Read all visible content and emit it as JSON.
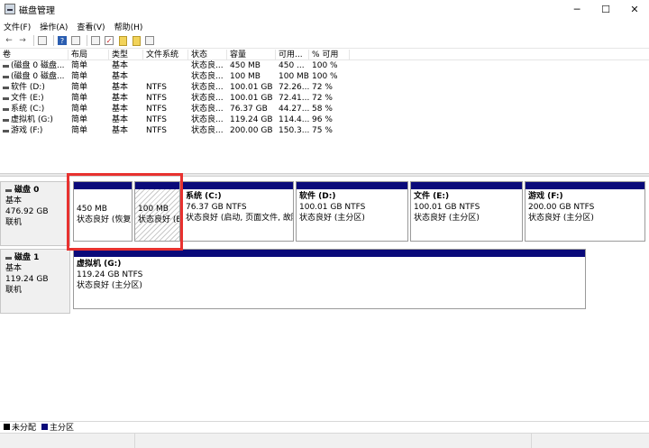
{
  "window": {
    "title": "磁盘管理",
    "minimize": "─",
    "maximize": "☐",
    "close": "✕"
  },
  "menu": [
    "文件(F)",
    "操作(A)",
    "查看(V)",
    "帮助(H)"
  ],
  "toolbar": {
    "back": "←",
    "forward": "→",
    "help": "?"
  },
  "volume_table": {
    "headers": [
      "卷",
      "布局",
      "类型",
      "文件系统",
      "状态",
      "容量",
      "可用...",
      "% 可用"
    ],
    "rows": [
      [
        "(磁盘 0 磁盘...",
        "简单",
        "基本",
        "",
        "状态良...",
        "450 MB",
        "450 ...",
        "100 %"
      ],
      [
        "(磁盘 0 磁盘...",
        "简单",
        "基本",
        "",
        "状态良...",
        "100 MB",
        "100 MB",
        "100 %"
      ],
      [
        "软件 (D:)",
        "简单",
        "基本",
        "NTFS",
        "状态良...",
        "100.01 GB",
        "72.26...",
        "72 %"
      ],
      [
        "文件 (E:)",
        "简单",
        "基本",
        "NTFS",
        "状态良...",
        "100.01 GB",
        "72.41...",
        "72 %"
      ],
      [
        "系统 (C:)",
        "简单",
        "基本",
        "NTFS",
        "状态良...",
        "76.37 GB",
        "44.27...",
        "58 %"
      ],
      [
        "虚拟机 (G:)",
        "简单",
        "基本",
        "NTFS",
        "状态良...",
        "119.24 GB",
        "114.4...",
        "96 %"
      ],
      [
        "游戏 (F:)",
        "简单",
        "基本",
        "NTFS",
        "状态良...",
        "200.00 GB",
        "150.3...",
        "75 %"
      ]
    ]
  },
  "disks": [
    {
      "name": "磁盘 0",
      "type": "基本",
      "size": "476.92 GB",
      "status": "联机",
      "partitions": [
        {
          "name": "",
          "size": "450 MB",
          "status": "状态良好 (恢复:"
        },
        {
          "name": "",
          "size": "100 MB",
          "status": "状态良好 (E"
        },
        {
          "name": "系统  (C:)",
          "size": "76.37 GB NTFS",
          "status": "状态良好 (启动, 页面文件, 故障"
        },
        {
          "name": "软件  (D:)",
          "size": "100.01 GB NTFS",
          "status": "状态良好 (主分区)"
        },
        {
          "name": "文件  (E:)",
          "size": "100.01 GB NTFS",
          "status": "状态良好 (主分区)"
        },
        {
          "name": "游戏  (F:)",
          "size": "200.00 GB NTFS",
          "status": "状态良好 (主分区)"
        }
      ]
    },
    {
      "name": "磁盘 1",
      "type": "基本",
      "size": "119.24 GB",
      "status": "联机",
      "partitions": [
        {
          "name": "虚拟机  (G:)",
          "size": "119.24 GB NTFS",
          "status": "状态良好 (主分区)"
        }
      ]
    }
  ],
  "legend": [
    {
      "label": "未分配",
      "color": "#000000"
    },
    {
      "label": "主分区",
      "color": "#0a0a7a"
    }
  ]
}
